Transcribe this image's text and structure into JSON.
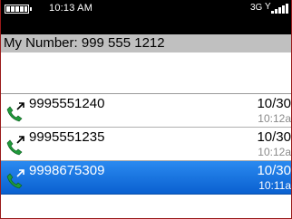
{
  "status_bar": {
    "time": "10:13 AM",
    "network": "3G",
    "battery_icon": "battery-full-icon",
    "signal_icon": "signal-bars-icon"
  },
  "header": {
    "my_number": "My Number: 999 555 1212"
  },
  "call_log": {
    "items": [
      {
        "number": "9995551240",
        "date": "10/30",
        "time": "10:12a",
        "icon": "outgoing-call-icon",
        "selected": false
      },
      {
        "number": "9995551235",
        "date": "10/30",
        "time": "10:12a",
        "icon": "outgoing-call-icon",
        "selected": false
      },
      {
        "number": "9998675309",
        "date": "10/30",
        "time": "10:11a",
        "icon": "outgoing-call-icon",
        "selected": true
      }
    ]
  },
  "colors": {
    "selection": "#1e70d8",
    "header_band": "#c0c0c0",
    "phone_icon": "#1f9a3a"
  }
}
